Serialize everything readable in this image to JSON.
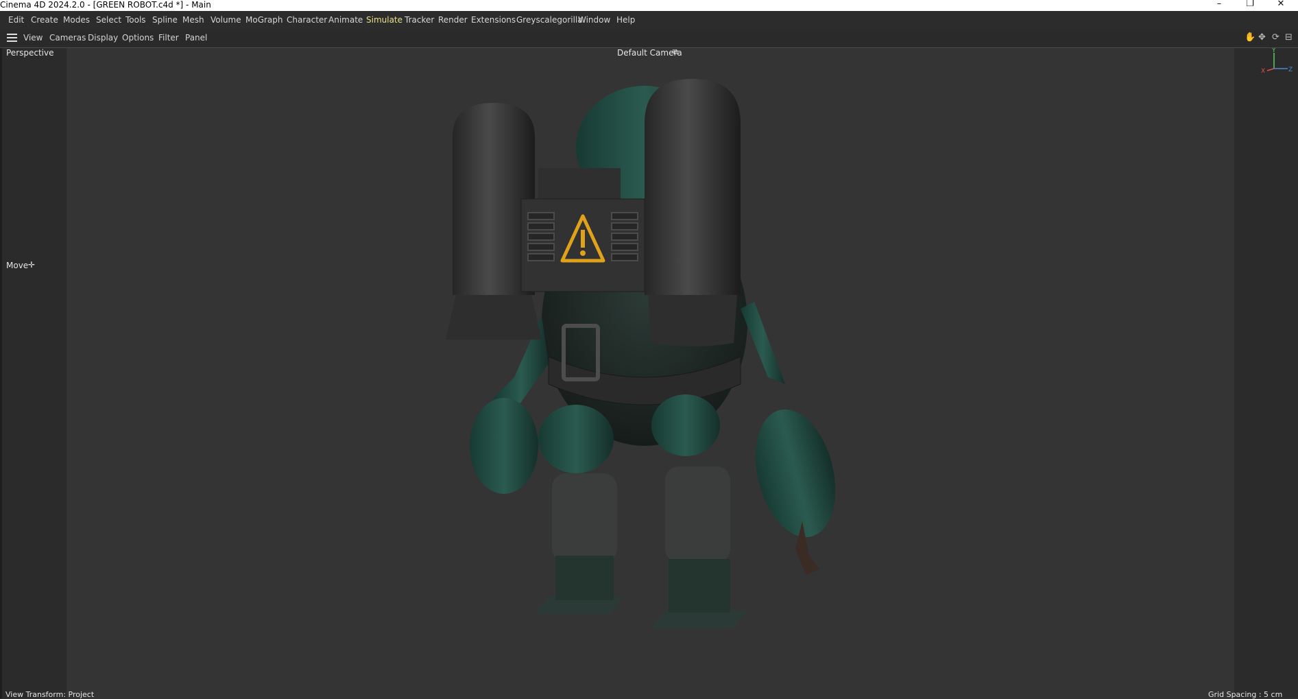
{
  "window": {
    "title": "Cinema 4D 2024.2.0 - [GREEN ROBOT.c4d *] - Main",
    "controls": {
      "minimize": "–",
      "maximize": "❐",
      "close": "✕"
    }
  },
  "menu": {
    "items": [
      "Edit",
      "Create",
      "Modes",
      "Select",
      "Tools",
      "Spline",
      "Mesh",
      "Volume",
      "MoGraph",
      "Character",
      "Animate",
      "Simulate",
      "Tracker",
      "Render",
      "Extensions",
      "Greyscalegorilla",
      "Window",
      "Help"
    ],
    "active": "Simulate"
  },
  "viewport_menu": {
    "items": [
      "View",
      "Cameras",
      "Display",
      "Options",
      "Filter",
      "Panel"
    ]
  },
  "viewport": {
    "projection": "Perspective",
    "camera": "Default Camera",
    "camera_icon": "camera-link-icon",
    "tool": "Move",
    "tool_icon": "move-cross-icon",
    "status_left": "View Transform: Project",
    "status_right": "Grid Spacing : 5 cm",
    "axis": {
      "y": "Y",
      "x": "X",
      "z": "Z"
    }
  },
  "colors": {
    "accent_menu_active": "#e8e089",
    "robot_green": "#1f4a42",
    "warning_yellow": "#e1a21b",
    "axis_y": "#5ccf5c",
    "axis_x": "#e05050",
    "axis_z": "#4a8ad8"
  }
}
